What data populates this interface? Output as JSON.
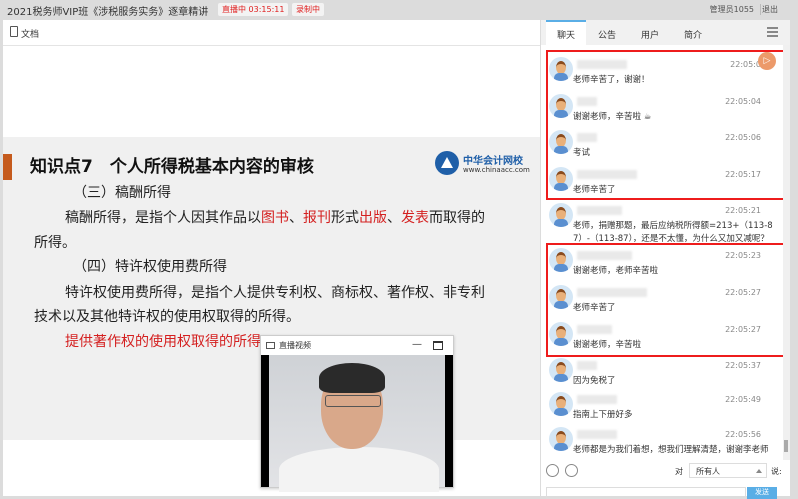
{
  "header": {
    "title": "2021税务师VIP班《涉税服务实务》逐章精讲",
    "live_badge": "直播中 03:15:11",
    "record_badge": "录制中",
    "user": "管理员1055",
    "logout": "退出"
  },
  "doc": {
    "label": "文档",
    "slide": {
      "title": "知识点7　个人所得税基本内容的审核",
      "logo_name": "中华会计网校",
      "logo_url": "www.chinaacc.com",
      "h3": "（三）稿酬所得",
      "p1a": "稿酬所得，是指个人因其作品以",
      "p1b": "图书",
      "p1c": "、",
      "p1d": "报刊",
      "p1e": "形式",
      "p1f": "出版",
      "p1g": "、",
      "p1h": "发表",
      "p1i": "而取得的",
      "p1j": "所得。",
      "h4": "（四）特许权使用费所得",
      "p2a": "特许权使用费所得，是指个人提供专利权、商标权、著作权、非专利",
      "p2b": "技术以及其他特许权的使用权取得的所得。",
      "p3": "提供著作权的使用权取得的所得"
    }
  },
  "video": {
    "title": "直播视频"
  },
  "chat": {
    "tabs": [
      "聊天",
      "公告",
      "用户",
      "简介"
    ],
    "messages": [
      {
        "time": "22:05:0",
        "text": "老师辛苦了，谢谢！"
      },
      {
        "time": "22:05:04",
        "text": "谢谢老师，辛苦啦 ☕"
      },
      {
        "time": "22:05:06",
        "text": "考试"
      },
      {
        "time": "22:05:17",
        "text": "老师辛苦了"
      },
      {
        "time": "22:05:21",
        "text": "老师，捐赠那题，最后应纳税所得额=213+（113-8",
        "text2": "7）-（113-87），还是不太懂，为什么又加又减呢？"
      },
      {
        "time": "22:05:23",
        "text": "谢谢老师，老师辛苦啦"
      },
      {
        "time": "22:05:27",
        "text": "老师辛苦了"
      },
      {
        "time": "22:05:27",
        "text": "谢谢老师，辛苦啦"
      },
      {
        "time": "22:05:37",
        "text": "因为免税了"
      },
      {
        "time": "22:05:49",
        "text": "指南上下册好多"
      },
      {
        "time": "22:05:56",
        "text": "老师都是为我们着想，想我们理解清楚，谢谢李老师"
      }
    ],
    "to_label": "对",
    "recipient": "所有人",
    "say_label": "说:",
    "send": "发送"
  },
  "colors": {
    "accent": "#5aaee6",
    "red": "#ee1c1c",
    "slide_bar": "#c55a1c"
  }
}
